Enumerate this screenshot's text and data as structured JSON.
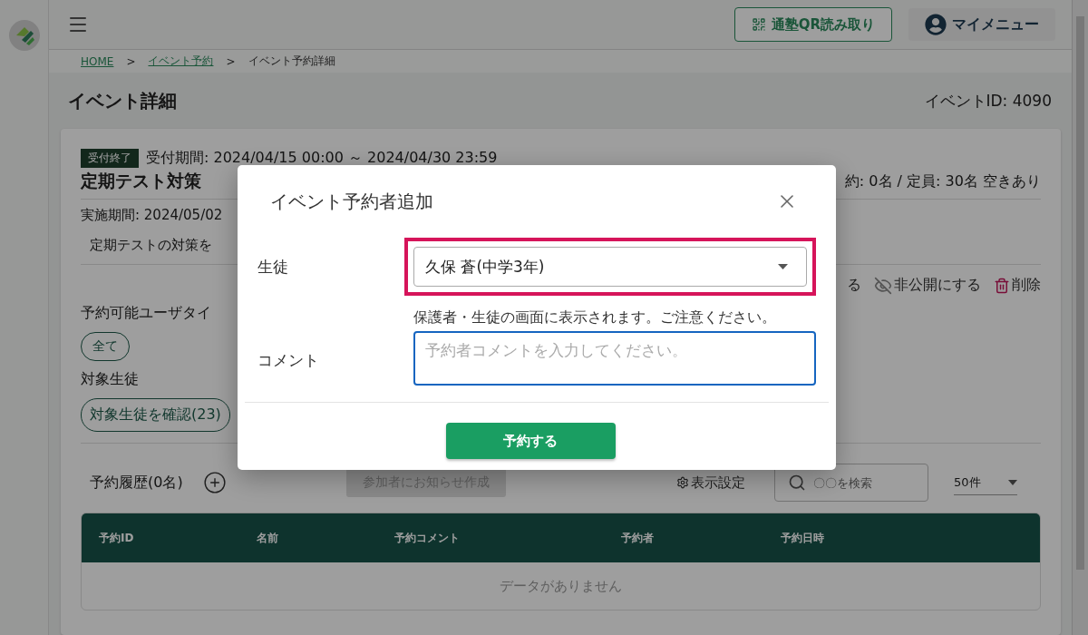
{
  "header": {
    "qr_button": "通塾QR読み取り",
    "my_menu": "マイメニュー"
  },
  "breadcrumb": [
    {
      "kind": "link",
      "label": "HOME"
    },
    {
      "kind": "separator",
      "label": ">"
    },
    {
      "kind": "link",
      "label": "イベント予約"
    },
    {
      "kind": "separator",
      "label": ">"
    },
    {
      "kind": "current",
      "label": "イベント予約詳細"
    }
  ],
  "page_title": "イベント詳細",
  "event_id": "イベントID: 4090",
  "event": {
    "status_badge": "受付終了",
    "reception_period": "受付期間: 2024/04/15 00:00 ～ 2024/04/30 23:59",
    "title": "定期テスト対策",
    "capacity": "約: 0名 / 定員: 30名 空きあり",
    "implementation_period": "実施期間: 2024/05/02",
    "description": "定期テストの対策を",
    "actions": [
      {
        "kind": "publish",
        "label": "る"
      },
      {
        "kind": "hide",
        "label": "非公開にする"
      },
      {
        "kind": "delete",
        "label": "削除"
      }
    ],
    "user_types_label": "予約可能ユーザタイ",
    "user_type_chips": [
      "全て"
    ],
    "target_label": "対象生徒",
    "target_button": "対象生徒を確認(23)"
  },
  "reservations": {
    "title": "予約履歴(0名)",
    "notify_button": {
      "label": "参加者にお知らせ作成",
      "disabled": true
    },
    "display_settings": "表示設定",
    "search_placeholder": "〇〇を検索",
    "page_size": "50件",
    "columns": [
      "予約ID",
      "名前",
      "予約コメント",
      "予約者",
      "予約日時"
    ],
    "empty_message": "データがありません"
  },
  "dialog": {
    "title": "イベント予約者追加",
    "student_label": "生徒",
    "student_value": "久保 蒼(中学3年)",
    "student_highlighted": true,
    "comment_label": "コメント",
    "comment_hint": "保護者・生徒の画面に表示されます。ご注意ください。",
    "comment_placeholder": "予約者コメントを入力してください。",
    "comment_focused": true,
    "submit_button": "予約する"
  }
}
